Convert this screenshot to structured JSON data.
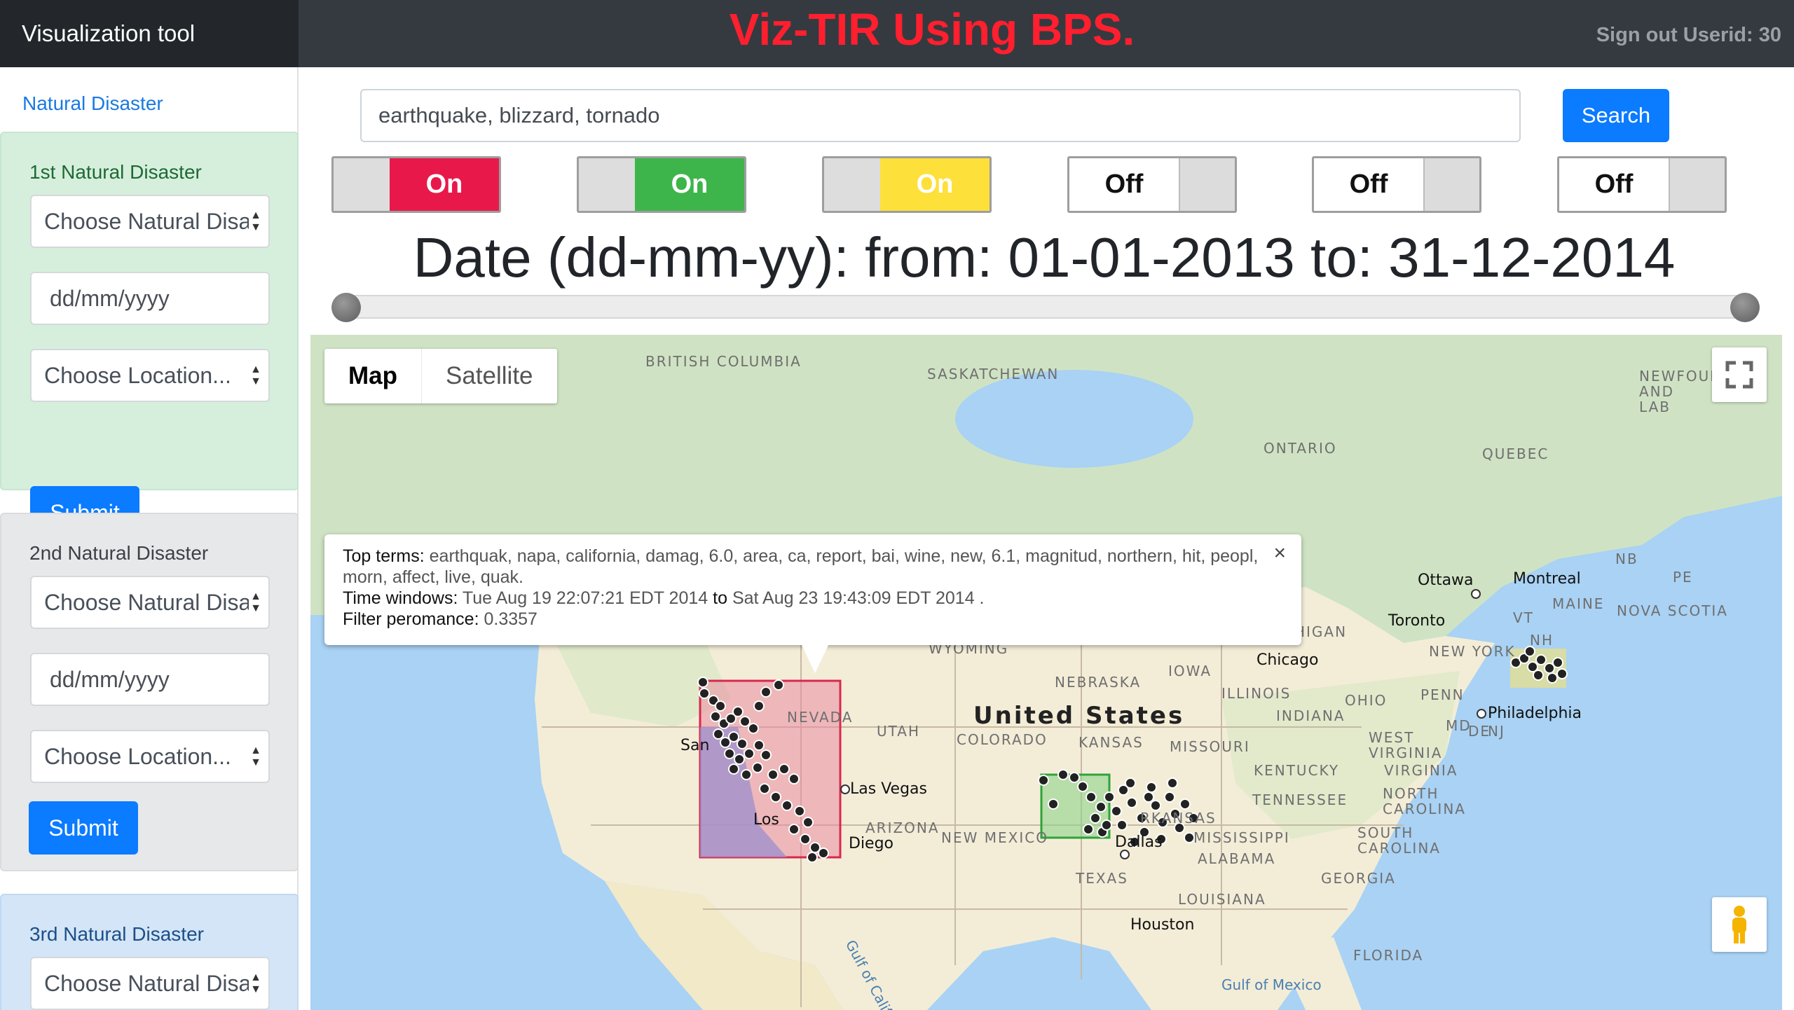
{
  "header": {
    "brand": "Visualization tool",
    "title": "Viz-TIR Using BPS.",
    "signout": "Sign out",
    "userid": "Userid: 30",
    "title_color": "#ff1f2e"
  },
  "sidebar": {
    "heading": "Natural Disaster",
    "panels": [
      {
        "title": "1st Natural Disaster",
        "disaster_select": "Choose Natural Disa",
        "date_placeholder": "dd/mm/yyyy",
        "location_select": "Choose Location...",
        "submit": "Submit"
      },
      {
        "title": "2nd Natural Disaster",
        "disaster_select": "Choose Natural Disa",
        "date_placeholder": "dd/mm/yyyy",
        "location_select": "Choose Location...",
        "submit": "Submit"
      },
      {
        "title": "3rd Natural Disaster",
        "disaster_select": "Choose Natural Disa"
      }
    ]
  },
  "search": {
    "value": "earthquake, blizzard, tornado",
    "button": "Search"
  },
  "toggles": [
    {
      "state": "On",
      "color": "#e8194a"
    },
    {
      "state": "On",
      "color": "#3db54a"
    },
    {
      "state": "On",
      "color": "#fde03a"
    },
    {
      "state": "Off"
    },
    {
      "state": "Off"
    },
    {
      "state": "Off"
    }
  ],
  "date_range": {
    "text": "Date (dd-mm-yy): from: 01-01-2013 to: 31-12-2014",
    "from": "01-01-2013",
    "to": "31-12-2014"
  },
  "map": {
    "type_map": "Map",
    "type_satellite": "Satellite",
    "popup": {
      "terms_label": "Top terms:",
      "terms_value": "earthquak, napa, california, damag, 6.0, area, ca, report, bai, wine, new, 6.1, magnitud, northern, hit, peopl, morn, affect, live, quak.",
      "time_label": "Time windows:",
      "time_from": "Tue Aug 19 22:07:21 EDT 2014",
      "time_to_word": "to",
      "time_to": "Sat Aug 23 19:43:09 EDT 2014 .",
      "filter_label": "Filter peromance:",
      "filter_value": "0.3357",
      "close": "×"
    },
    "labels": {
      "british_columbia": "BRITISH COLUMBIA",
      "saskatchewan": "SASKATCHEWAN",
      "ontario": "ONTARIO",
      "quebec": "QUEBEC",
      "newfoundland": "NEWFOUN AND LAB",
      "nb": "NB",
      "pe": "PE",
      "maine": "MAINE",
      "nova_scotia": "NOVA SCOTIA",
      "vt": "VT",
      "nh": "NH",
      "new_york": "NEW YORK",
      "penn": "PENN",
      "ohio": "OHIO",
      "indiana": "INDIANA",
      "illinois": "ILLINOIS",
      "iowa": "IOWA",
      "nebraska": "NEBRASKA",
      "kansas": "KANSAS",
      "missouri": "MISSOURI",
      "kentucky": "KENTUCKY",
      "virginia": "VIRGINIA",
      "west_virginia": "WEST VIRGINIA",
      "md": "MD",
      "de": "DE",
      "nj": "NJ",
      "tennessee": "TENNESSEE",
      "north_carolina": "NORTH CAROLINA",
      "south_carolina": "SOUTH CAROLINA",
      "arkansas": "RKANSAS",
      "mississippi": "MISSISSIPPI",
      "alabama": "ALABAMA",
      "georgia": "GEORGIA",
      "louisiana": "LOUISIANA",
      "florida": "FLORIDA",
      "texas": "TEXAS",
      "new_mexico": "NEW MEXICO",
      "arizona": "ARIZONA",
      "utah": "UTAH",
      "colorado": "COLORADO",
      "nevada": "NEVADA",
      "wyoming": "WYOMING",
      "michigan": "CHIGAN",
      "united_states": "United States",
      "ottawa": "Ottawa",
      "montreal": "Montreal",
      "toronto": "Toronto",
      "chicago": "Chicago",
      "philadelphia": "Philadelphia",
      "las_vegas": "Las Vegas",
      "diego": "Diego",
      "san": "San",
      "los": "Los",
      "dallas": "Dallas",
      "houston": "Houston",
      "gulf_california": "Gulf of California",
      "gulf_mexico": "Gulf of Mexico"
    }
  }
}
